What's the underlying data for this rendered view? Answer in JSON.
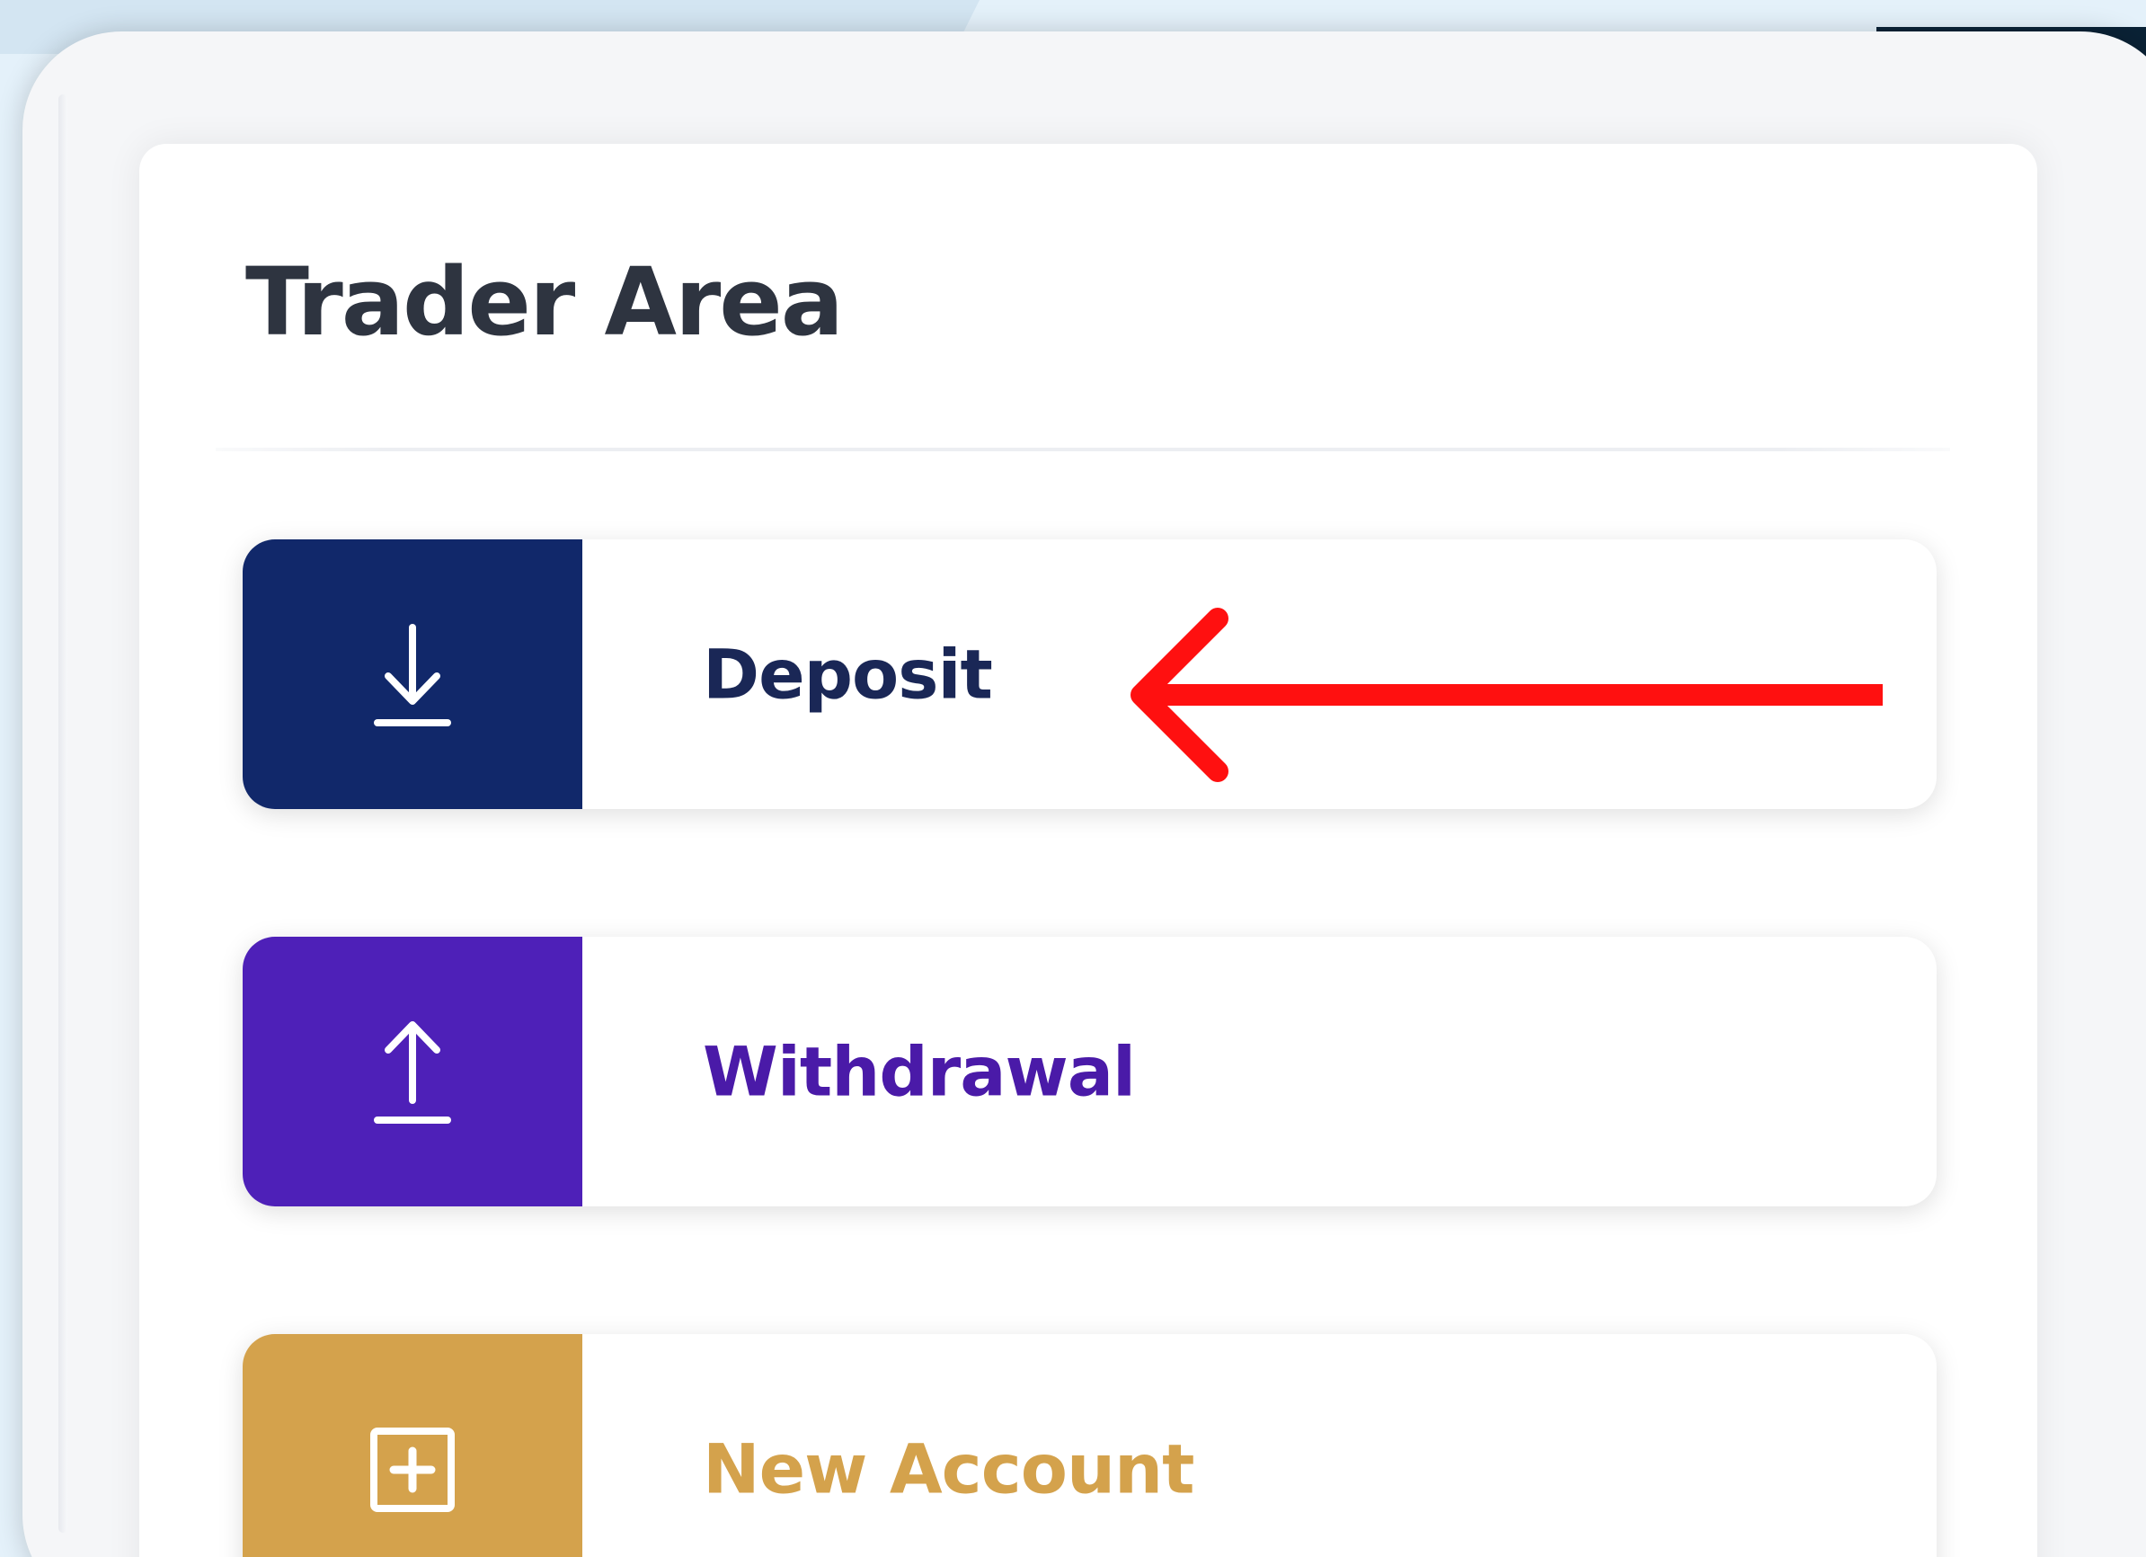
{
  "theme": {
    "deposit_color": "#11286a",
    "withdrawal_color": "#4e20b8",
    "new_account_color": "#d4a24c",
    "arrow_color": "#ff1010"
  },
  "card": {
    "title": "Trader Area"
  },
  "actions": [
    {
      "label": "Deposit",
      "icon": "arrow-down-to-line-icon",
      "color": "#11286a",
      "text_color": "#1a2756"
    },
    {
      "label": "Withdrawal",
      "icon": "arrow-up-from-line-icon",
      "color": "#4e20b8",
      "text_color": "#4a1aa8"
    },
    {
      "label": "New Account",
      "icon": "plus-square-icon",
      "color": "#d4a24c",
      "text_color": "#d4a24c"
    }
  ],
  "annotation": {
    "icon": "left-arrow-annotation-icon",
    "color": "#ff1010"
  }
}
